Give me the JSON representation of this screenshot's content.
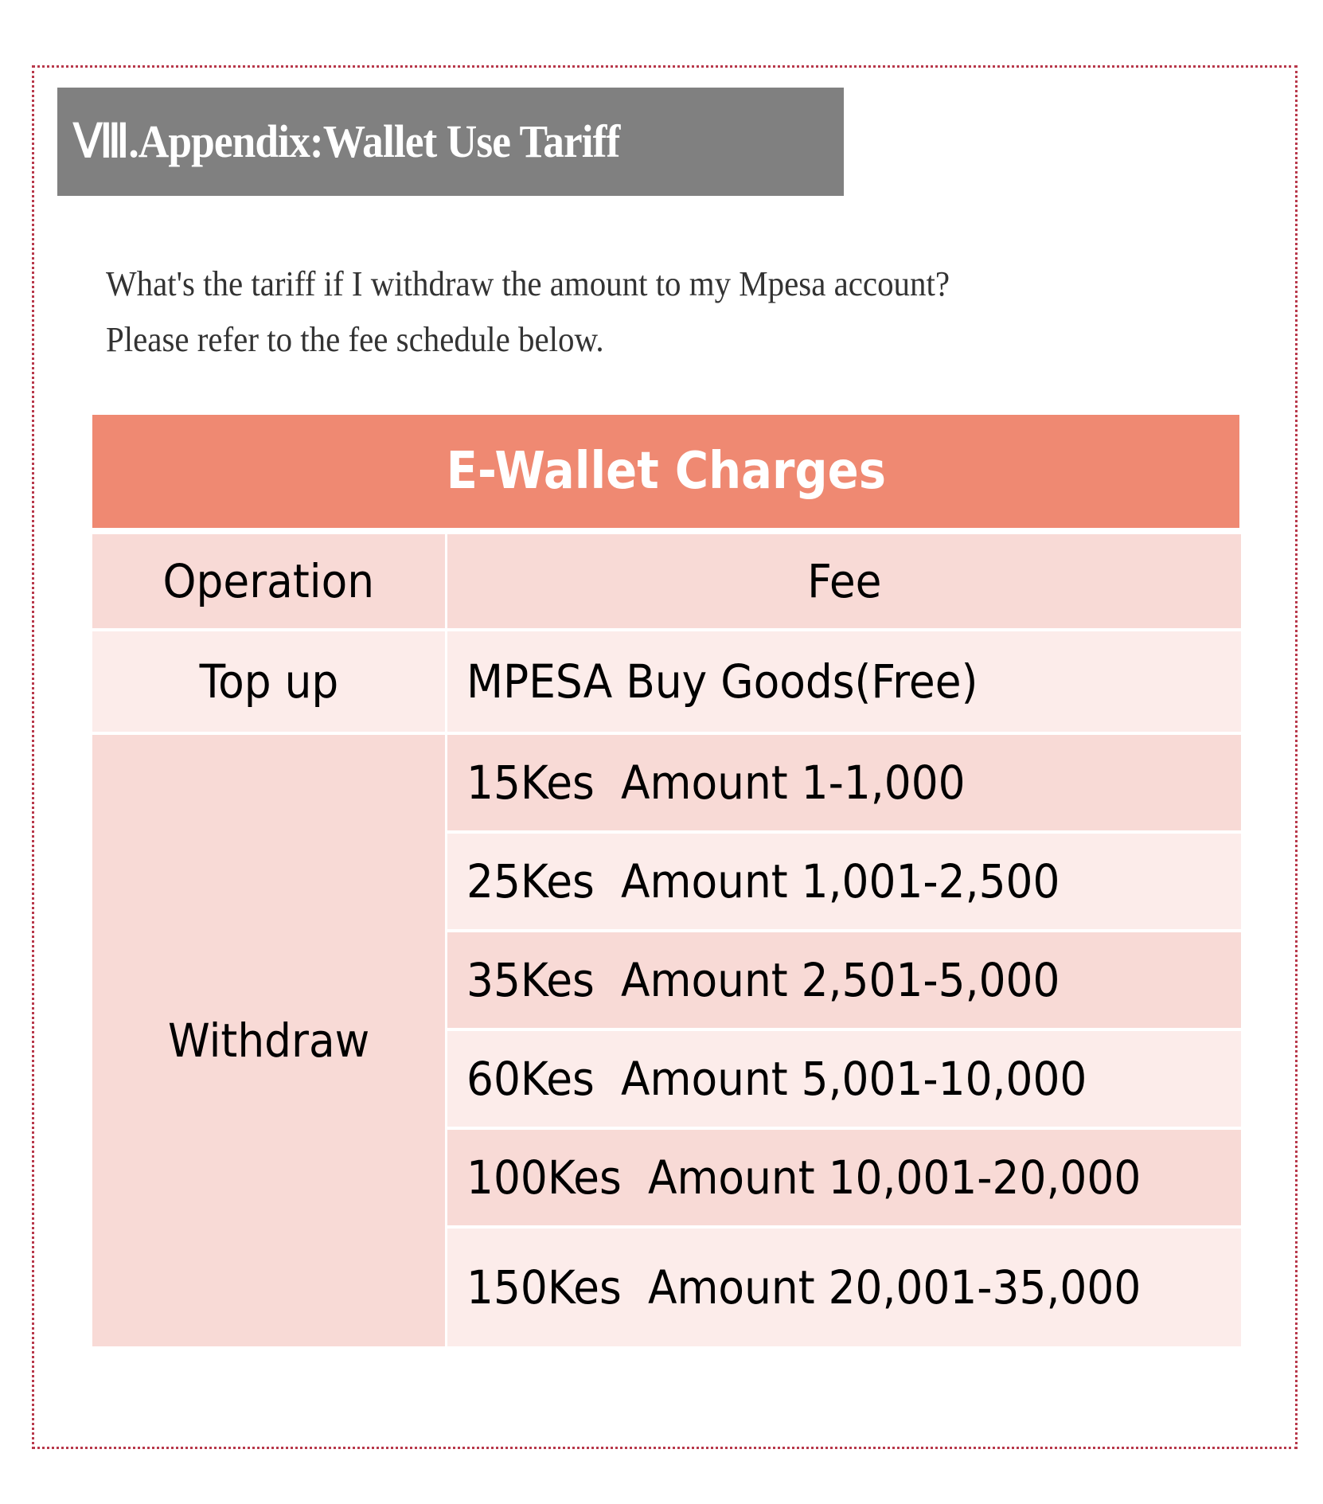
{
  "section": {
    "heading": "Ⅷ.Appendix:Wallet Use Tariff"
  },
  "intro": {
    "line1": "What's the tariff if I withdraw the amount to my Mpesa account?",
    "line2": "Please refer to the fee schedule below."
  },
  "table": {
    "title": "E-Wallet Charges",
    "headers": {
      "operation": "Operation",
      "fee": "Fee"
    },
    "topup": {
      "operation": "Top up",
      "fee": "MPESA Buy Goods(Free)"
    },
    "withdraw": {
      "operation": "Withdraw",
      "tiers": [
        {
          "fee": "15Kes",
          "range": "Amount 1-1,000"
        },
        {
          "fee": "25Kes",
          "range": "Amount 1,001-2,500"
        },
        {
          "fee": "35Kes",
          "range": "Amount 2,501-5,000"
        },
        {
          "fee": "60Kes",
          "range": "Amount 5,001-10,000"
        },
        {
          "fee": "100Kes",
          "range": "Amount 10,001-20,000"
        },
        {
          "fee": "150Kes",
          "range": "Amount 20,001-35,000"
        }
      ]
    }
  },
  "colors": {
    "title_bg": "#ef8972",
    "row_dark": "#f8dad6",
    "row_light": "#fcecea",
    "heading_bg": "#808080",
    "frame_border": "#b8384a"
  }
}
